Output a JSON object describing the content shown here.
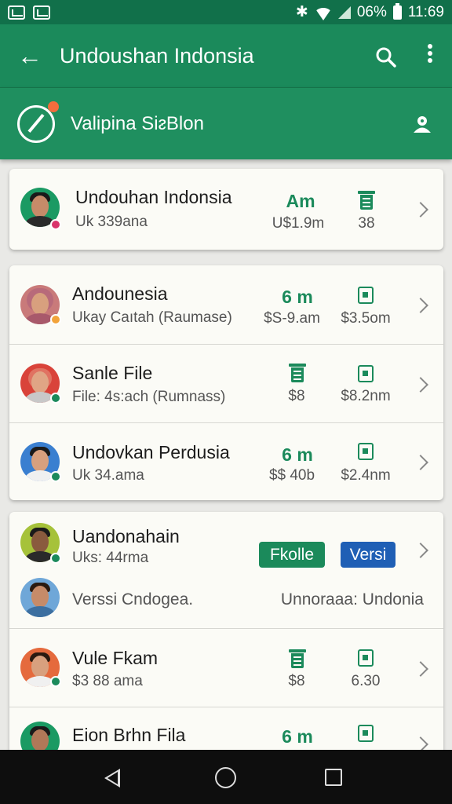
{
  "status_bar": {
    "battery": "06%",
    "time": "11:69"
  },
  "app_bar": {
    "title": "Undoushan Indonsia"
  },
  "sub_bar": {
    "title": "Valipina SiᴤBlon"
  },
  "colors": {
    "primary": "#1b8a5b",
    "status": "#11704a",
    "pill_green": "#1b8a5b",
    "pill_blue": "#1f5fb5"
  },
  "card1": {
    "name": "Undouhan Indonsia",
    "sub": "Uk 339ana",
    "stat1_value": "Am",
    "stat1_sub": "U$1.9m",
    "stat2_icon": "battery-icon",
    "stat2_sub": "38"
  },
  "card2": [
    {
      "name": "Andounesia",
      "sub": "Ukay Caıtah (Raumase)",
      "stat1_value": "6 m",
      "stat1_sub": "$S-9.am",
      "stat2_icon": "square-icon",
      "stat2_sub": "$3.5om"
    },
    {
      "name": "Sanle File",
      "sub": "File: 4s:ach (Rumnass)",
      "stat1_icon": "bin-icon",
      "stat1_sub": "$8",
      "stat2_icon": "square-icon",
      "stat2_sub": "$8.2nm"
    },
    {
      "name": "Undovkan Perdusia",
      "sub": "Uk 34.ama",
      "stat1_value": "6 m",
      "stat1_sub": "$$ 40b",
      "stat2_icon": "square-icon",
      "stat2_sub": "$2.4nm"
    }
  ],
  "card3": {
    "top": {
      "name": "Uandonahain",
      "sub": "Uks: 44rma",
      "pill_green": "Fkolle",
      "pill_blue": "Versi"
    },
    "second": {
      "left": "Verssi Cndogea.",
      "right": "Unnoraaa: Undonia"
    },
    "rows": [
      {
        "name": "Vule Fkam",
        "sub": "$3 88 ama",
        "stat1_icon": "bin-icon",
        "stat1_sub": "$8",
        "stat2_icon": "square-icon",
        "stat2_sub": "6.30"
      },
      {
        "name": "Eion Brhn Fila",
        "stat1_value": "6 m",
        "stat2_icon": "square-icon"
      }
    ]
  }
}
